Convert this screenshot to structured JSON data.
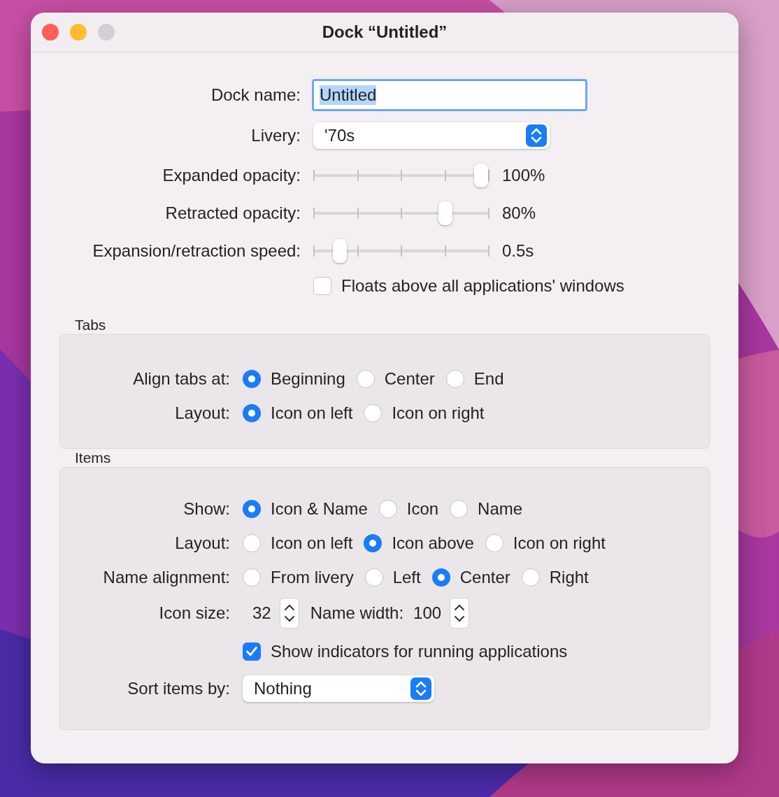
{
  "window": {
    "title": "Dock “Untitled”",
    "buttons": [
      {
        "kind": "close"
      },
      {
        "kind": "minimize"
      },
      {
        "kind": "zoom",
        "disabled": true
      }
    ]
  },
  "dock_name": {
    "label": "Dock name:",
    "value": "Untitled"
  },
  "livery": {
    "label": "Livery:",
    "value": "'70s"
  },
  "sliders": [
    {
      "label": "Expanded opacity:",
      "level": 1,
      "reading": "100%"
    },
    {
      "label": "Retracted opacity:",
      "level": 0.78,
      "reading": "80%"
    },
    {
      "label": "Expansion/retraction speed:",
      "level": 0.12,
      "reading": "0.5s"
    }
  ],
  "floats": {
    "label": "Floats above all applications' windows",
    "checked": false
  },
  "tabs_group": {
    "title": "Tabs",
    "rows": [
      {
        "label": "Align tabs at:",
        "options": [
          {
            "label": "Beginning",
            "selected": true
          },
          {
            "label": "Center",
            "selected": false
          },
          {
            "label": "End",
            "selected": false
          }
        ]
      },
      {
        "label": "Layout:",
        "options": [
          {
            "label": "Icon on left",
            "selected": true
          },
          {
            "label": "Icon on right",
            "selected": false
          }
        ]
      }
    ]
  },
  "items_group": {
    "title": "Items",
    "rows": [
      {
        "label": "Show:",
        "options": [
          {
            "label": "Icon & Name",
            "selected": true
          },
          {
            "label": "Icon",
            "selected": false
          },
          {
            "label": "Name",
            "selected": false
          }
        ]
      },
      {
        "label": "Layout:",
        "options": [
          {
            "label": "Icon on left",
            "selected": false
          },
          {
            "label": "Icon above",
            "selected": true
          },
          {
            "label": "Icon on right",
            "selected": false
          }
        ]
      },
      {
        "label": "Name alignment:",
        "options": [
          {
            "label": "From livery",
            "selected": false
          },
          {
            "label": "Left",
            "selected": false
          },
          {
            "label": "Center",
            "selected": true
          },
          {
            "label": "Right",
            "selected": false
          }
        ]
      }
    ],
    "icon_size": {
      "label": "Icon size:",
      "value": "32"
    },
    "name_width": {
      "label": "Name width:",
      "value": "100"
    },
    "indicators": {
      "label": "Show indicators for running applications",
      "checked": true
    },
    "sort": {
      "label": "Sort items by:",
      "value": "Nothing"
    }
  }
}
